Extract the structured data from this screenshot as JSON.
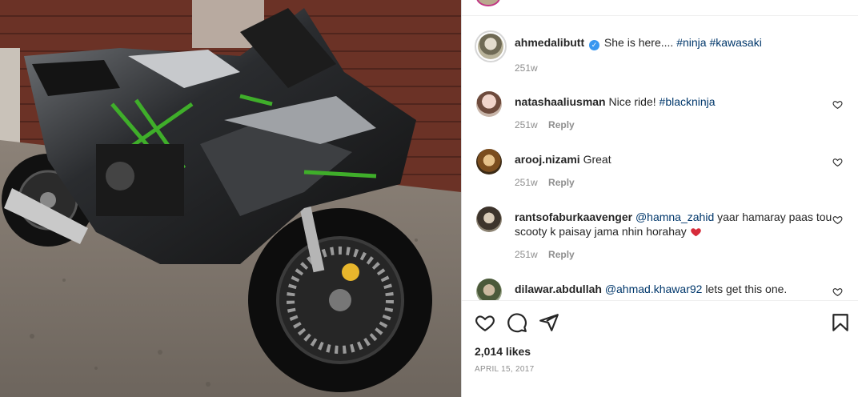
{
  "post": {
    "author": "ahmedalibutt",
    "caption": "She is here....",
    "hashtags": [
      "#ninja",
      "#kawasaki"
    ],
    "time": "251w"
  },
  "comments": [
    {
      "user": "natashaaliusman",
      "text": "Nice ride!",
      "tags": "#blackninja",
      "time": "251w",
      "reply": "Reply"
    },
    {
      "user": "arooj.nizami",
      "text": "Great",
      "time": "251w",
      "reply": "Reply"
    },
    {
      "user": "rantsofaburkaavenger",
      "mention": "@hamna_zahid",
      "text": "yaar hamaray paas tou scooty k paisay jama nhin horahay",
      "time": "251w",
      "reply": "Reply"
    },
    {
      "user": "dilawar.abdullah",
      "mention": "@ahmad.khawar92",
      "text": "lets get this one."
    }
  ],
  "actions": {
    "like_icon": "heart-icon",
    "comment_icon": "comment-icon",
    "share_icon": "send-icon",
    "save_icon": "bookmark-icon"
  },
  "likes": "2,014 likes",
  "date": "APRIL 15, 2017",
  "colors": {
    "link": "#00376b",
    "meta": "#8e8e8e",
    "verified": "#3897f0",
    "heart": "#ed4956"
  }
}
